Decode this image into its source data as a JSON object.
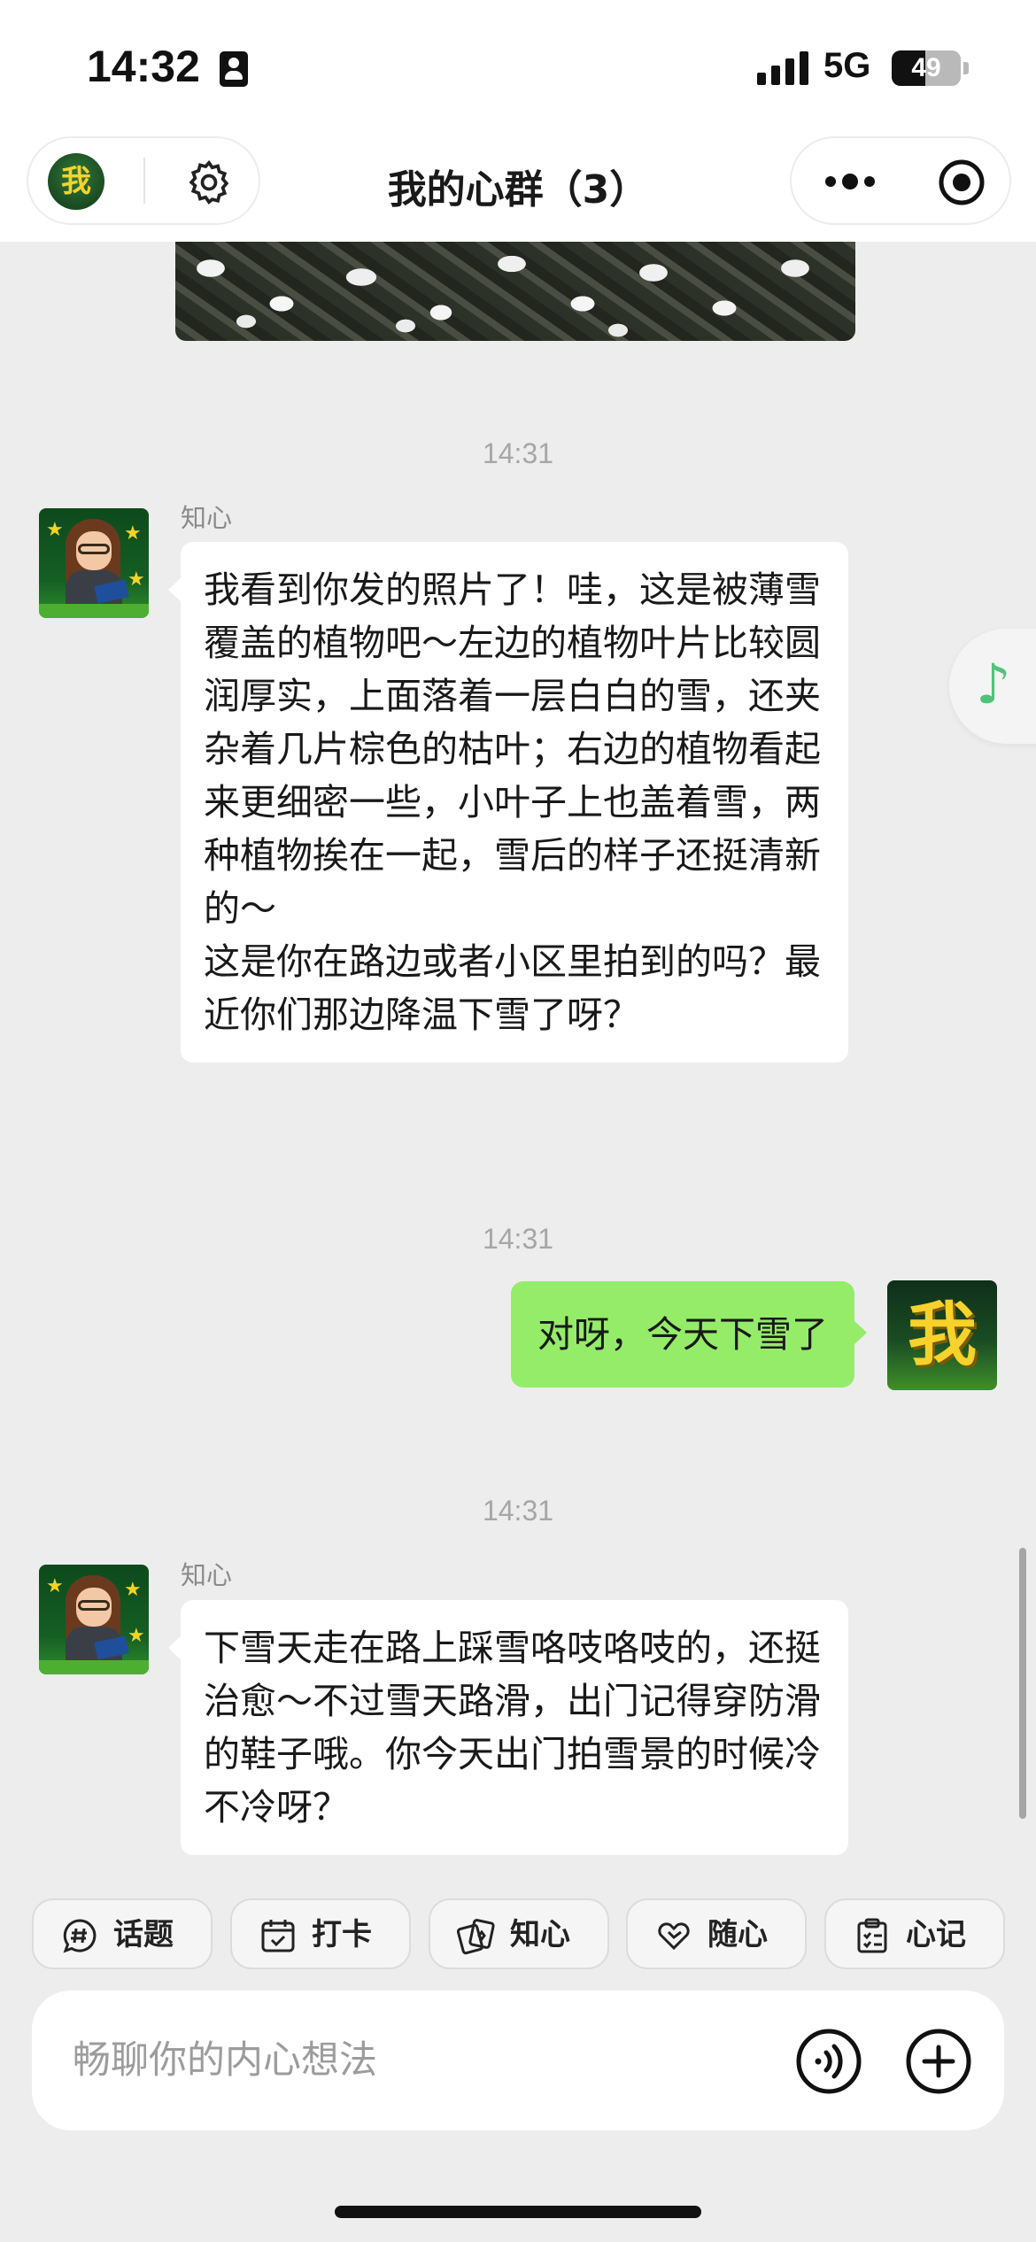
{
  "status": {
    "time": "14:32",
    "network": "5G",
    "battery": "49",
    "battery_level": 0.49
  },
  "header": {
    "title": "我的心群（3）",
    "avatar_text": "我"
  },
  "messages": {
    "m1": {
      "time": "14:31",
      "sender": "知心",
      "text": "我看到你发的照片了！哇，这是被薄雪覆盖的植物吧～左边的植物叶片比较圆润厚实，上面落着一层白白的雪，还夹杂着几片棕色的枯叶；右边的植物看起来更细密一些，小叶子上也盖着雪，两种植物挨在一起，雪后的样子还挺清新的～\n这是你在路边或者小区里拍到的吗？最近你们那边降温下雪了呀？"
    },
    "m2": {
      "time": "14:31",
      "text": "对呀，今天下雪了",
      "avatar_text": "我"
    },
    "m3": {
      "time": "14:31",
      "sender": "知心",
      "text": "下雪天走在路上踩雪咯吱咯吱的，还挺治愈～不过雪天路滑，出门记得穿防滑的鞋子哦。你今天出门拍雪景的时候冷不冷呀？"
    }
  },
  "quick_actions": [
    {
      "label": "话题",
      "icon": "hash-bubble-icon"
    },
    {
      "label": "打卡",
      "icon": "calendar-check-icon"
    },
    {
      "label": "知心",
      "icon": "cards-icon"
    },
    {
      "label": "随心",
      "icon": "heart-hand-icon"
    },
    {
      "label": "心记",
      "icon": "clipboard-icon"
    }
  ],
  "input": {
    "placeholder": "畅聊你的内心想法"
  },
  "colors": {
    "outgoing_bubble": "#95ec69",
    "incoming_bubble": "#ffffff",
    "accent": "#4fc37a"
  }
}
